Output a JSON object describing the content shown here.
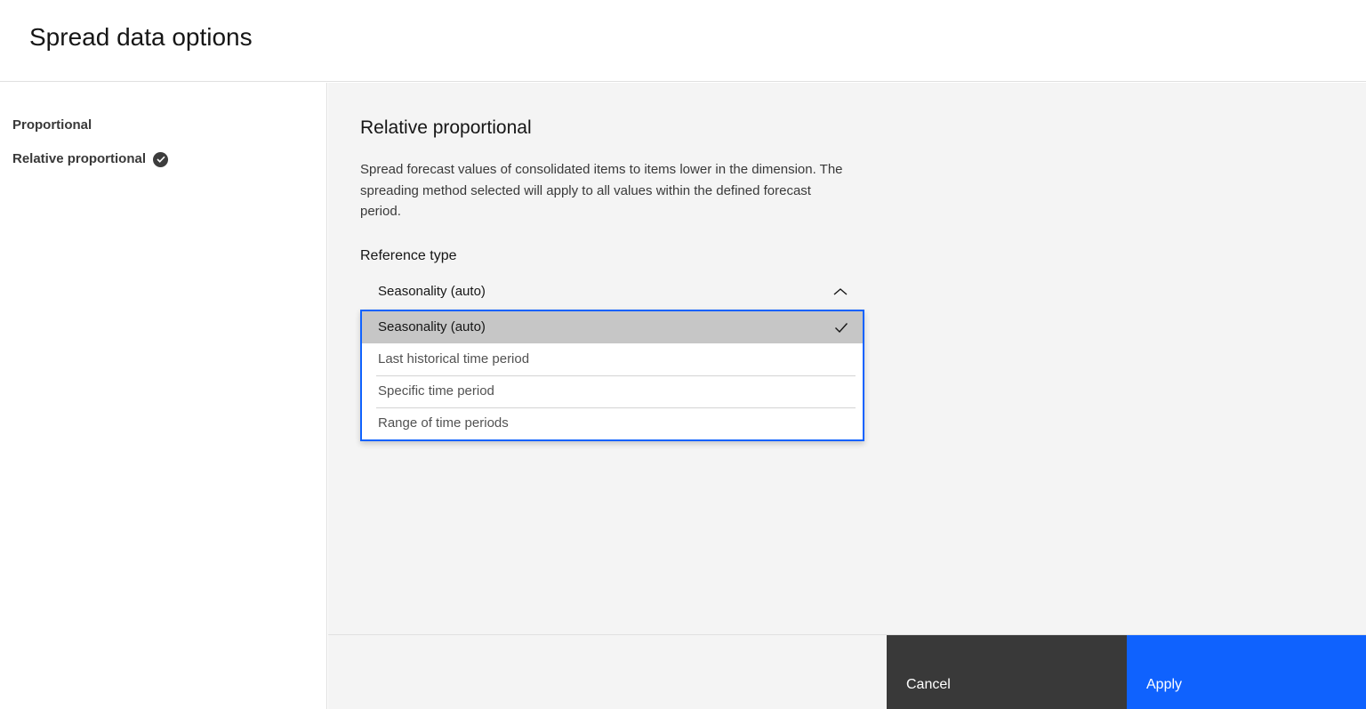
{
  "header": {
    "title": "Spread data options"
  },
  "sidebar": {
    "items": [
      {
        "label": "Proportional",
        "selected": false,
        "configured": false
      },
      {
        "label": "Relative proportional",
        "selected": true,
        "configured": true
      }
    ]
  },
  "main": {
    "heading": "Relative proportional",
    "description": "Spread forecast values of consolidated items to items lower in the dimension. The spreading method selected will apply to all values within the defined forecast period.",
    "reference_type_label": "Reference type",
    "dropdown": {
      "selected_value": "Seasonality (auto)",
      "state": "open",
      "options": [
        {
          "label": "Seasonality (auto)",
          "selected": true
        },
        {
          "label": "Last historical time period",
          "selected": false
        },
        {
          "label": "Specific time period",
          "selected": false
        },
        {
          "label": "Range of time periods",
          "selected": false
        }
      ]
    }
  },
  "footer": {
    "cancel_label": "Cancel",
    "apply_label": "Apply"
  },
  "colors": {
    "accent_blue": "#0f62fe",
    "secondary_button": "#393939",
    "panel_background": "#f4f4f4",
    "selected_option_background": "#c6c6c6",
    "primary_text": "#161616",
    "secondary_text": "#525252",
    "divider": "#e0e0e0"
  },
  "icons": {
    "sidebar_done_badge": "check-circle",
    "dropdown_trigger": "chevron-up",
    "selected_option": "checkmark"
  }
}
